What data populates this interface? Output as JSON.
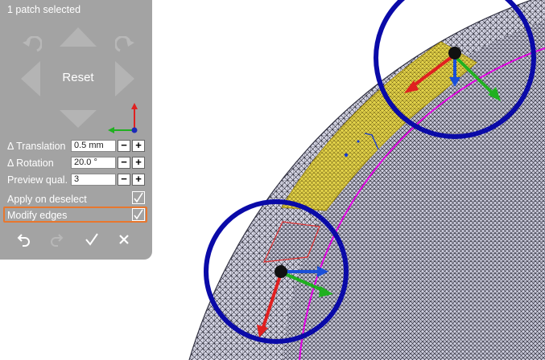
{
  "panel": {
    "status": "1 patch selected",
    "reset_label": "Reset",
    "translation": {
      "label": "Δ Translation",
      "value": "0.5 mm"
    },
    "rotation": {
      "label": "Δ Rotation",
      "value": "20.0 °"
    },
    "preview": {
      "label": "Preview qual.",
      "value": "3"
    },
    "apply_on_deselect": {
      "label": "Apply on deselect",
      "checked": true
    },
    "modify_edges": {
      "label": "Modify edges",
      "checked": true
    },
    "stepper_minus": "−",
    "stepper_plus": "+",
    "icons": {
      "undo": "undo-icon",
      "redo": "redo-icon",
      "accept": "checkmark-icon",
      "cancel": "close-icon",
      "nav_up": "arrow-up-icon",
      "nav_down": "arrow-down-icon",
      "nav_left": "arrow-left-icon",
      "nav_right": "arrow-right-icon",
      "rotate_left": "rotate-left-icon",
      "rotate_right": "rotate-right-icon"
    }
  },
  "colors": {
    "panel_bg": "#a3a3a3",
    "highlight": "#e8772e",
    "gizmo_ring": "#0000a8",
    "axis_x": "#e02020",
    "axis_y": "#20b020",
    "axis_z": "#1a4fd8",
    "patch": "#e0d040",
    "edge_line": "#e000e0",
    "mesh_fill": "#d8d8e6"
  }
}
